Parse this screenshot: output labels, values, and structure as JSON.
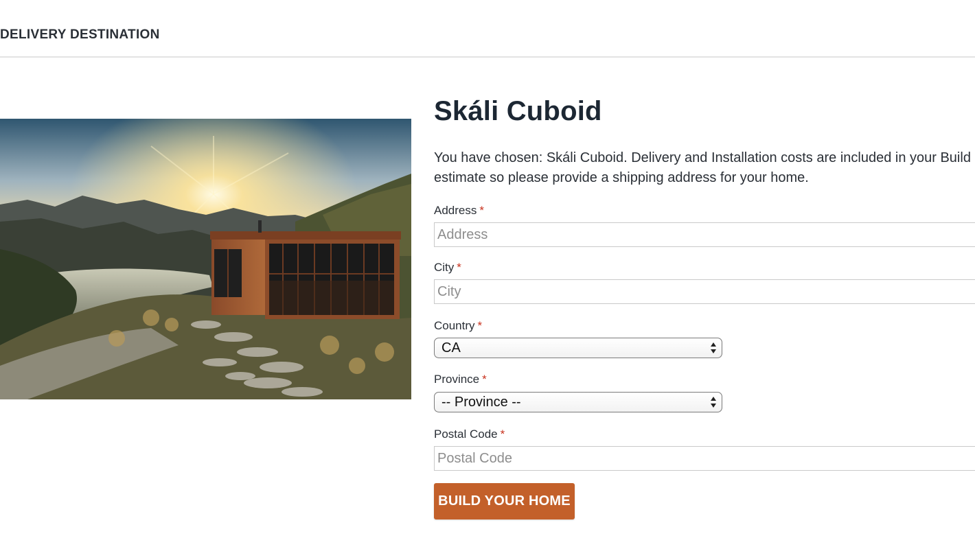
{
  "header": {
    "title": "DELIVERY DESTINATION"
  },
  "hero": {
    "icon": "cabin-landscape-photo"
  },
  "product": {
    "title": "Skáli Cuboid",
    "intro_line1": "You have chosen: Skáli Cuboid. Delivery and Installation costs are included in your Build",
    "intro_line2": "estimate so please provide a shipping address for your home."
  },
  "form": {
    "required_mark": "*",
    "address": {
      "label": "Address",
      "placeholder": "Address",
      "value": ""
    },
    "city": {
      "label": "City",
      "placeholder": "City",
      "value": ""
    },
    "country": {
      "label": "Country",
      "selected": "CA"
    },
    "province": {
      "label": "Province",
      "selected": "-- Province --"
    },
    "postal": {
      "label": "Postal Code",
      "placeholder": "Postal Code",
      "value": ""
    },
    "submit_label": "BUILD YOUR HOME"
  },
  "colors": {
    "accent": "#c3602a",
    "required": "#c8321e",
    "heading": "#1c2733"
  }
}
